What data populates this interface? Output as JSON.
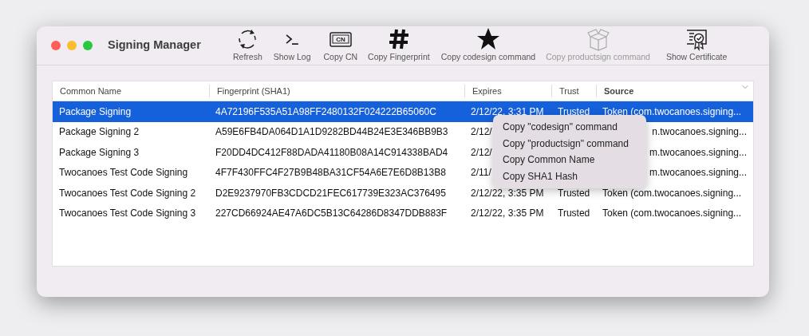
{
  "window": {
    "title": "Signing Manager"
  },
  "toolbar": [
    {
      "label": "Refresh",
      "kind": "refresh",
      "disabled": false
    },
    {
      "label": "Show Log",
      "kind": "terminal",
      "disabled": false
    },
    {
      "label": "Copy CN",
      "kind": "card",
      "icon_text": "CN",
      "disabled": false
    },
    {
      "label": "Copy Fingerprint",
      "kind": "hash",
      "disabled": false
    },
    {
      "label": "Copy codesign command",
      "kind": "star",
      "disabled": false
    },
    {
      "label": "Copy productsign command",
      "kind": "box",
      "disabled": true
    },
    {
      "label": "Show Certificate",
      "kind": "certificate",
      "disabled": false
    }
  ],
  "table": {
    "columns": [
      {
        "label": "Common Name",
        "sorted": false
      },
      {
        "label": "Fingerprint (SHA1)",
        "sorted": false
      },
      {
        "label": "Expires",
        "sorted": false
      },
      {
        "label": "Trust",
        "sorted": false
      },
      {
        "label": "Source",
        "sorted": true
      }
    ],
    "rows": [
      {
        "selected": true,
        "cells": [
          "Package Signing",
          "4A72196F535A51A98FF2480132F024222B65060C",
          "2/12/22, 3:31 PM",
          "Trusted",
          "Token (com.twocanoes.signing..."
        ]
      },
      {
        "selected": false,
        "cells": [
          "Package Signing 2",
          "A59E6FB4DA064D1A1D9282BD44B24E3E346BB9B3",
          "2/12/",
          null,
          "n.twocanoes.signing..."
        ]
      },
      {
        "selected": false,
        "cells": [
          "Package Signing 3",
          "F20DD4DC412F88DADA41180B08A14C914338BAD4",
          "2/12/",
          null,
          "m.twocanoes.signing..."
        ]
      },
      {
        "selected": false,
        "cells": [
          "Twocanoes Test Code Signing",
          "4F7F430FFC4F27B9B48BA31CF54A6E7E6D8B13B8",
          "2/11/",
          null,
          "m.twocanoes.signing..."
        ]
      },
      {
        "selected": false,
        "cells": [
          "Twocanoes Test Code Signing 2",
          "D2E9237970FB3CDCD21FEC617739E323AC376495",
          "2/12/22, 3:35 PM",
          "Trusted",
          "Token (com.twocanoes.signing..."
        ]
      },
      {
        "selected": false,
        "cells": [
          "Twocanoes Test Code Signing 3",
          "227CD66924AE47A6DC5B13C64286D8347DDB883F",
          "2/12/22, 3:35 PM",
          "Trusted",
          "Token (com.twocanoes.signing..."
        ]
      }
    ]
  },
  "context_menu": [
    "Copy \"codesign\" command",
    "Copy \"productsign\" command",
    "Copy Common Name",
    "Copy SHA1 Hash"
  ]
}
